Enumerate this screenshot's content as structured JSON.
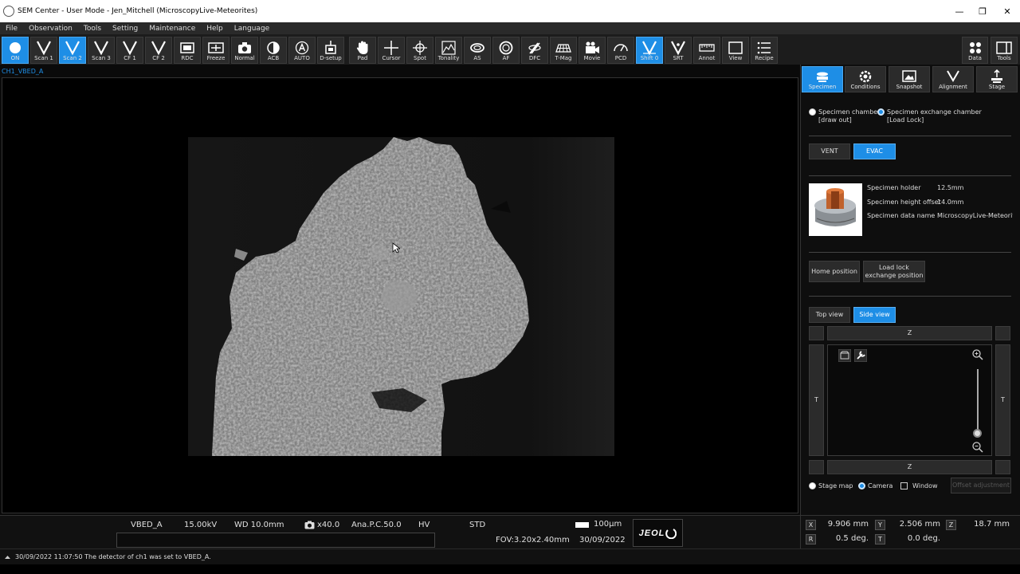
{
  "window": {
    "title": "SEM Center - User Mode - Jen_Mitchell (MicroscopyLive-Meteorites)",
    "minimize": "—",
    "maximize": "❐",
    "close": "✕"
  },
  "menu": [
    "File",
    "Observation",
    "Tools",
    "Setting",
    "Maintenance",
    "Help",
    "Language"
  ],
  "toolbar": {
    "buttons": [
      {
        "label": "ON",
        "icon": "power-icon",
        "active": true
      },
      {
        "label": "Scan 1",
        "icon": "scan-icon",
        "active": false
      },
      {
        "label": "Scan 2",
        "icon": "scan-icon",
        "active": true
      },
      {
        "label": "Scan 3",
        "icon": "scan-icon",
        "active": false
      },
      {
        "label": "CF 1",
        "icon": "scan-icon",
        "active": false
      },
      {
        "label": "CF 2",
        "icon": "scan-icon",
        "active": false
      },
      {
        "label": "RDC",
        "icon": "rdc-icon",
        "active": false
      },
      {
        "label": "Freeze",
        "icon": "freeze-icon",
        "active": false
      },
      {
        "label": "Normal",
        "icon": "camera-icon",
        "active": false
      },
      {
        "label": "ACB",
        "icon": "contrast-icon",
        "active": false
      },
      {
        "label": "AUTO",
        "icon": "auto-icon",
        "active": false
      },
      {
        "label": "D-setup",
        "icon": "detector-setup-icon",
        "active": false
      },
      {
        "label": "Pad",
        "icon": "hand-icon",
        "active": false
      },
      {
        "label": "Cursor",
        "icon": "crosshair-icon",
        "active": false
      },
      {
        "label": "Spot",
        "icon": "spot-icon",
        "active": false
      },
      {
        "label": "Tonality",
        "icon": "tonality-icon",
        "active": false
      },
      {
        "label": "AS",
        "icon": "astigmatism-icon",
        "active": false
      },
      {
        "label": "AF",
        "icon": "autofocus-icon",
        "active": false
      },
      {
        "label": "DFC",
        "icon": "dfc-icon",
        "active": false
      },
      {
        "label": "T-Mag",
        "icon": "t-mag-icon",
        "active": false
      },
      {
        "label": "Movie",
        "icon": "movie-icon",
        "active": false
      },
      {
        "label": "PCD",
        "icon": "pcd-icon",
        "active": false
      },
      {
        "label": "Shift 0",
        "icon": "shift-icon",
        "active": true
      },
      {
        "label": "SRT",
        "icon": "srt-icon",
        "active": false
      },
      {
        "label": "Annot",
        "icon": "ruler-icon",
        "active": false
      },
      {
        "label": "View",
        "icon": "view-icon",
        "active": false
      },
      {
        "label": "Recipe",
        "icon": "recipe-icon",
        "active": false
      }
    ],
    "data_label": "Data",
    "tools_label": "Tools"
  },
  "image": {
    "tab_label": "CH1_VBED_A"
  },
  "status": {
    "detector": "VBED_A",
    "voltage": "15.00kV",
    "wd": "WD 10.0mm",
    "mag": "x40.0",
    "probe": "Ana.P.C.50.0",
    "vacuum": "HV",
    "mode": "STD",
    "scale": "100μm",
    "fov": "FOV:3.20x2.40mm",
    "date": "30/09/2022",
    "logo": "JEOL"
  },
  "log": {
    "message": "30/09/2022 11:07:50 The detector of ch1 was set to VBED_A."
  },
  "right_panel": {
    "tabs": [
      {
        "label": "Specimen",
        "active": true
      },
      {
        "label": "Conditions",
        "active": false
      },
      {
        "label": "Snapshot",
        "active": false
      },
      {
        "label": "Alignment",
        "active": false
      },
      {
        "label": "Stage",
        "active": false
      }
    ],
    "chamber": {
      "option1_line1": "Specimen chamber",
      "option1_line2": "[draw out]",
      "option2_line1": "Specimen exchange chamber",
      "option2_line2": "[Load Lock]"
    },
    "vent_label": "VENT",
    "evac_label": "EVAC",
    "holder": {
      "holder_label": "Specimen holder",
      "holder_value": "12.5mm",
      "height_label": "Specimen height offset",
      "height_value": "14.0mm",
      "name_label": "Specimen data name",
      "name_value": "MicroscopyLive-Meteorites"
    },
    "home_position": "Home position",
    "load_lock_line1": "Load lock",
    "load_lock_line2": "exchange position",
    "top_view": "Top view",
    "side_view": "Side view",
    "z_label": "Z",
    "t_label": "T",
    "options": {
      "stage_map": "Stage map",
      "camera": "Camera",
      "window": "Window",
      "offset": "Offset adjustment"
    }
  },
  "coords": {
    "x_label": "X",
    "x_value": "9.906 mm",
    "y_label": "Y",
    "y_value": "2.506 mm",
    "z_label": "Z",
    "z_value": "18.7 mm",
    "r_label": "R",
    "r_value": "0.5 deg.",
    "t_label": "T",
    "t_value": "0.0 deg."
  },
  "colors": {
    "accent": "#1e8ee6",
    "background": "#0a0a0a",
    "panel": "#2b2b2b"
  }
}
